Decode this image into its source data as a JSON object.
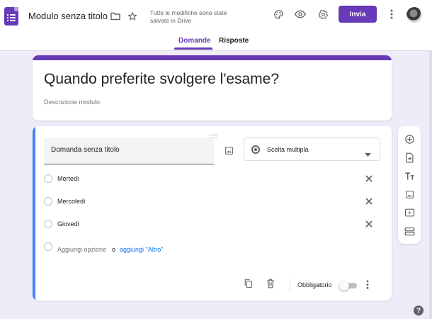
{
  "header": {
    "form_title": "Modulo senza titolo",
    "save_status": "Tutte le modifiche sono state salvate in Drive",
    "send_label": "Invia",
    "icons": [
      "forms-logo-icon",
      "folder-icon",
      "star-icon",
      "palette-icon",
      "preview-eye-icon",
      "settings-gear-icon",
      "more-vert-icon",
      "avatar"
    ],
    "accent_color": "#673ab7"
  },
  "tabs": [
    {
      "label": "Domande",
      "active": true
    },
    {
      "label": "Risposte",
      "active": false
    }
  ],
  "form": {
    "title": "Quando preferite svolgere l'esame?",
    "description_placeholder": "Descrizione modulo"
  },
  "question": {
    "title_placeholder": "Domanda senza titolo",
    "type_label": "Scelta multipla",
    "options": [
      {
        "label": "Mertedì"
      },
      {
        "label": "Mercoledì"
      },
      {
        "label": "Giovedì"
      }
    ],
    "add_option_label": "Aggiungi opzione",
    "or_label": "o",
    "add_other_label": "aggiungi \"Altro\"",
    "required_label": "Obbligatorio",
    "required": false
  },
  "side_toolbar": [
    "add-question-icon",
    "import-questions-icon",
    "add-title-icon",
    "add-image-icon",
    "add-video-icon",
    "add-section-icon"
  ]
}
